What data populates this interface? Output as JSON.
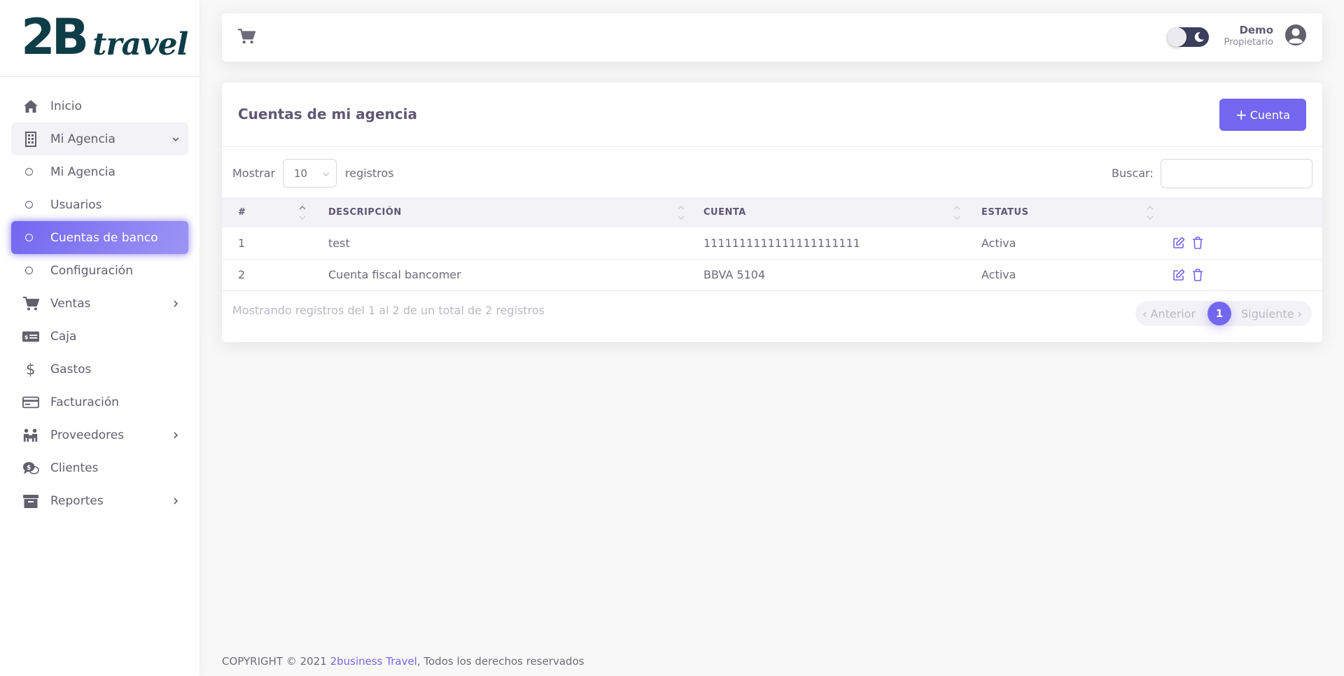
{
  "brand": {
    "logo_main": "2B",
    "logo_sub": "travel"
  },
  "sidebar": {
    "items": [
      {
        "label": "Inicio",
        "icon": "home-icon"
      },
      {
        "label": "Mi Agencia",
        "icon": "building-icon"
      },
      {
        "label": "Mi Agencia",
        "icon": "circle-icon"
      },
      {
        "label": "Usuarios",
        "icon": "circle-icon"
      },
      {
        "label": "Cuentas de banco",
        "icon": "circle-icon"
      },
      {
        "label": "Configuración",
        "icon": "circle-icon"
      },
      {
        "label": "Ventas",
        "icon": "cart-icon"
      },
      {
        "label": "Caja",
        "icon": "cash-icon"
      },
      {
        "label": "Gastos",
        "icon": "dollar-icon"
      },
      {
        "label": "Facturación",
        "icon": "credit-card-icon"
      },
      {
        "label": "Proveedores",
        "icon": "people-icon"
      },
      {
        "label": "Clientes",
        "icon": "chat-dollar-icon"
      },
      {
        "label": "Reportes",
        "icon": "archive-icon"
      }
    ]
  },
  "header": {
    "user_name": "Demo",
    "user_role": "Propietario"
  },
  "card": {
    "title": "Cuentas de mi agencia",
    "add_button": "Cuenta",
    "show_label": "Mostrar",
    "page_size": "10",
    "records_label": "registros",
    "search_label": "Buscar:",
    "columns": [
      "#",
      "DESCRIPCIÓN",
      "CUENTA",
      "ESTATUS"
    ],
    "rows": [
      {
        "num": "1",
        "description": "test",
        "account": "1111111111111111111111",
        "status": "Activa"
      },
      {
        "num": "2",
        "description": "Cuenta fiscal bancomer",
        "account": "BBVA 5104",
        "status": "Activa"
      }
    ],
    "info": "Mostrando registros del 1 al 2 de un total de 2 registros",
    "pager": {
      "prev": "Anterior",
      "current": "1",
      "next": "Siguiente"
    }
  },
  "footer": {
    "prefix": "COPYRIGHT © 2021 ",
    "link": "2business Travel",
    "suffix": ", Todos los derechos reservados"
  },
  "colors": {
    "accent": "#7367f0",
    "brand": "#0f3d47"
  }
}
